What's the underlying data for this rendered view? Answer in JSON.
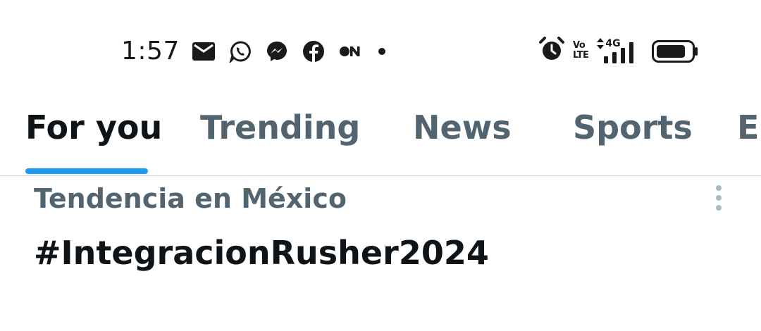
{
  "status_bar": {
    "time": "1:57",
    "notification_icons": [
      "email-icon",
      "whatsapp-icon",
      "messenger-icon",
      "facebook-icon",
      "on-app-icon",
      "more-dot-icon"
    ],
    "system_icons": [
      "alarm-icon",
      "volte-icon",
      "network-4g-icon",
      "signal-icon",
      "battery-icon"
    ],
    "volte_line1": "Vo",
    "volte_line2": "LTE",
    "network_type": "4G",
    "on_app_label": "ON"
  },
  "tabs": {
    "items": [
      {
        "label": "For you",
        "active": true
      },
      {
        "label": "Trending",
        "active": false
      },
      {
        "label": "News",
        "active": false
      },
      {
        "label": "Sports",
        "active": false
      },
      {
        "label": "En",
        "active": false
      }
    ]
  },
  "trend": {
    "context": "Tendencia en México",
    "title": "#IntegracionRusher2024"
  },
  "colors": {
    "accent": "#1d9bf0",
    "primary_text": "#0f1419",
    "secondary_text": "#536471",
    "divider": "#cfd9de"
  }
}
